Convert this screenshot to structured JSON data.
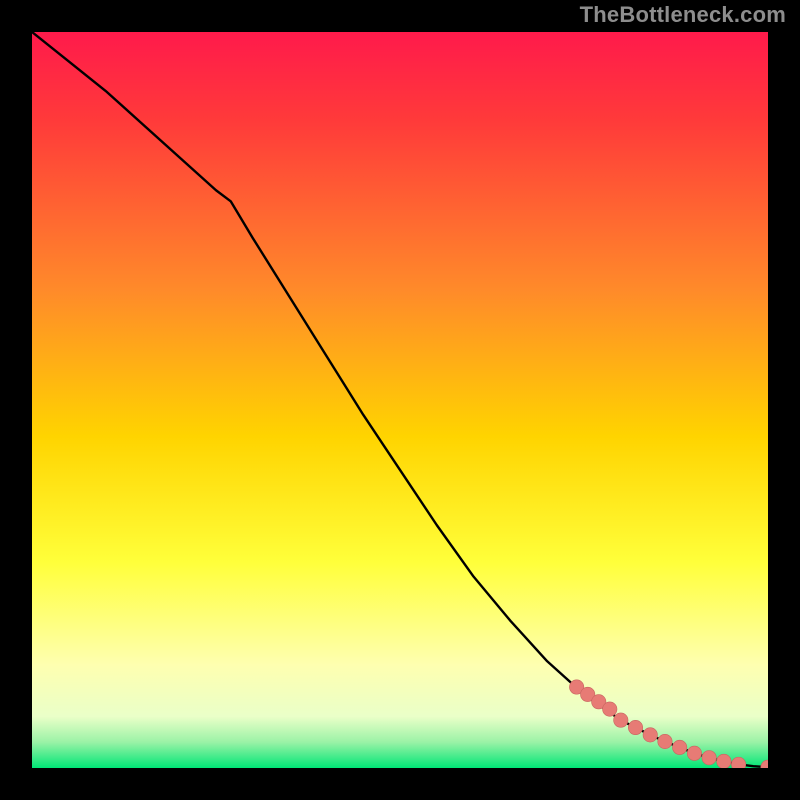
{
  "watermark": "TheBottleneck.com",
  "colors": {
    "page_bg": "#000000",
    "watermark": "#8d8d8d",
    "line": "#000000",
    "marker_fill": "#e77b75",
    "marker_stroke": "#c86560",
    "grad_top": "#ff1a4b",
    "grad_mid1": "#ff7a2a",
    "grad_mid2": "#ffd400",
    "grad_mid3": "#ffff4d",
    "grad_mid4": "#fdffd6",
    "grad_bottom": "#00f07a"
  },
  "chart_data": {
    "type": "line",
    "title": "",
    "xlabel": "",
    "ylabel": "",
    "xlim": [
      0,
      100
    ],
    "ylim": [
      0,
      100
    ],
    "series": [
      {
        "name": "curve",
        "x": [
          0,
          5,
          10,
          15,
          20,
          25,
          27,
          30,
          35,
          40,
          45,
          50,
          55,
          60,
          65,
          70,
          75,
          80,
          82,
          84,
          86,
          88,
          90,
          92,
          94,
          96,
          98,
          100
        ],
        "y": [
          100,
          96,
          92,
          87.5,
          83,
          78.5,
          77,
          72,
          64,
          56,
          48,
          40.5,
          33,
          26,
          20,
          14.5,
          10,
          6.5,
          5.5,
          4.5,
          3.6,
          2.8,
          2.0,
          1.4,
          0.9,
          0.5,
          0.25,
          0.1
        ],
        "markers_x": [
          74,
          75.5,
          77,
          78.5,
          80,
          82,
          84,
          86,
          88,
          90,
          92,
          94,
          96,
          100
        ],
        "markers_y": [
          11,
          10,
          9,
          8,
          6.5,
          5.5,
          4.5,
          3.6,
          2.8,
          2.0,
          1.4,
          0.9,
          0.5,
          0.1
        ]
      }
    ],
    "gradient_stops": [
      {
        "offset": 0.0,
        "color": "#ff1a4b"
      },
      {
        "offset": 0.12,
        "color": "#ff3a3a"
      },
      {
        "offset": 0.35,
        "color": "#ff8a2a"
      },
      {
        "offset": 0.55,
        "color": "#ffd400"
      },
      {
        "offset": 0.72,
        "color": "#ffff3a"
      },
      {
        "offset": 0.86,
        "color": "#feffb0"
      },
      {
        "offset": 0.93,
        "color": "#eaffc8"
      },
      {
        "offset": 0.965,
        "color": "#9af2a6"
      },
      {
        "offset": 1.0,
        "color": "#00e676"
      }
    ]
  }
}
